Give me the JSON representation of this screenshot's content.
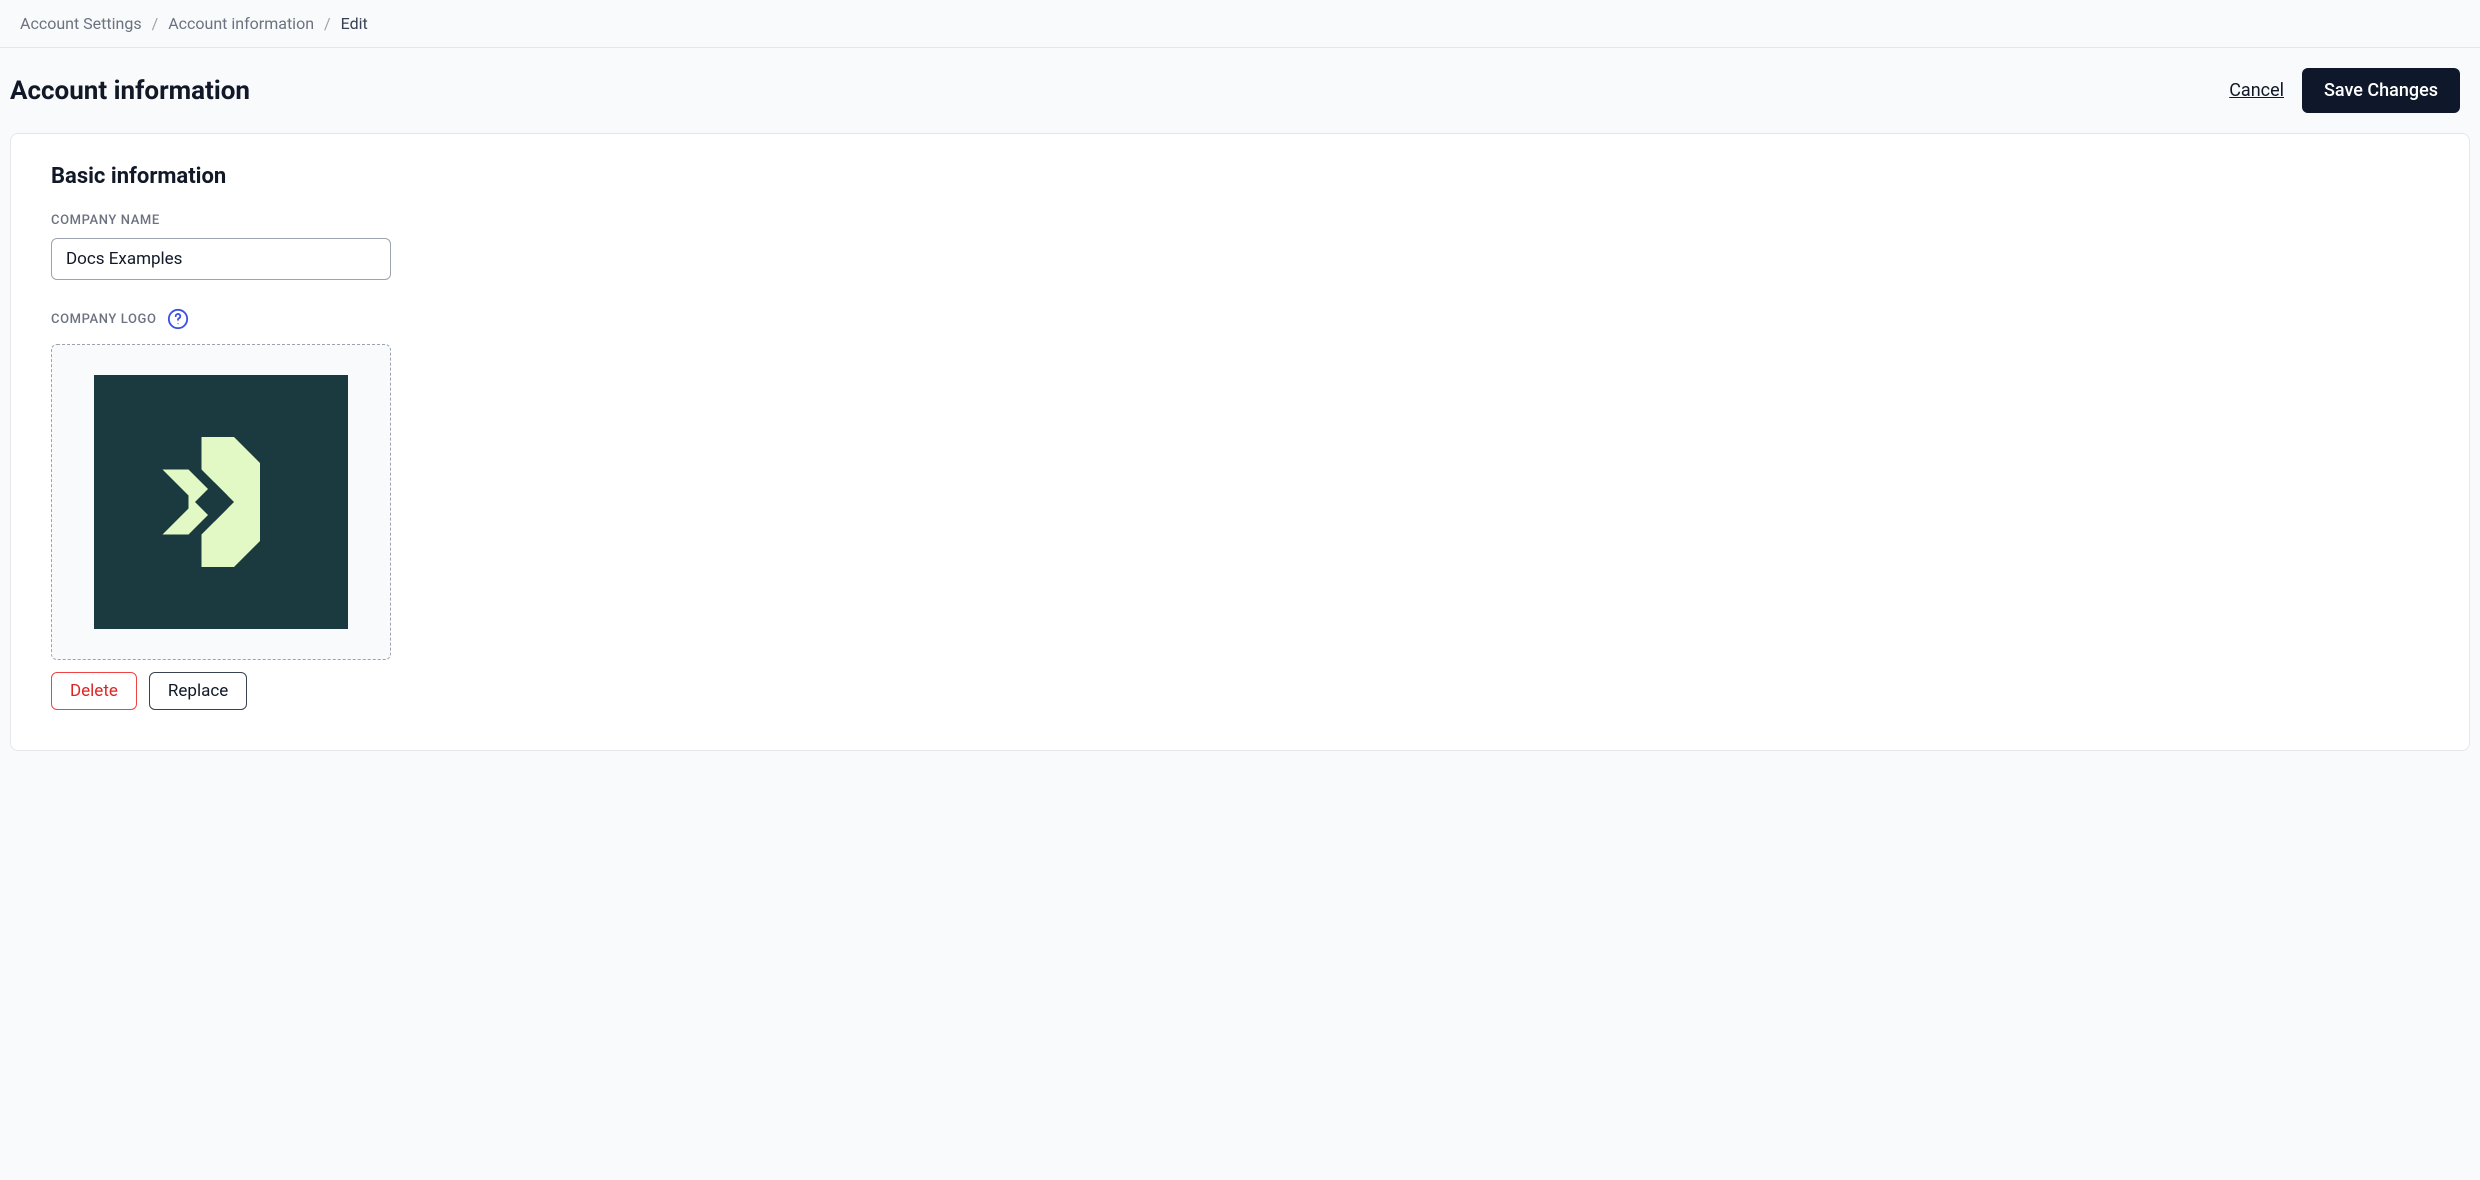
{
  "breadcrumb": {
    "items": [
      {
        "label": "Account Settings"
      },
      {
        "label": "Account information"
      },
      {
        "label": "Edit"
      }
    ]
  },
  "header": {
    "title": "Account information",
    "cancel_label": "Cancel",
    "save_label": "Save Changes"
  },
  "section": {
    "title": "Basic information",
    "company_name_label": "COMPANY NAME",
    "company_name_value": "Docs Examples",
    "company_logo_label": "COMPANY LOGO",
    "delete_label": "Delete",
    "replace_label": "Replace"
  }
}
